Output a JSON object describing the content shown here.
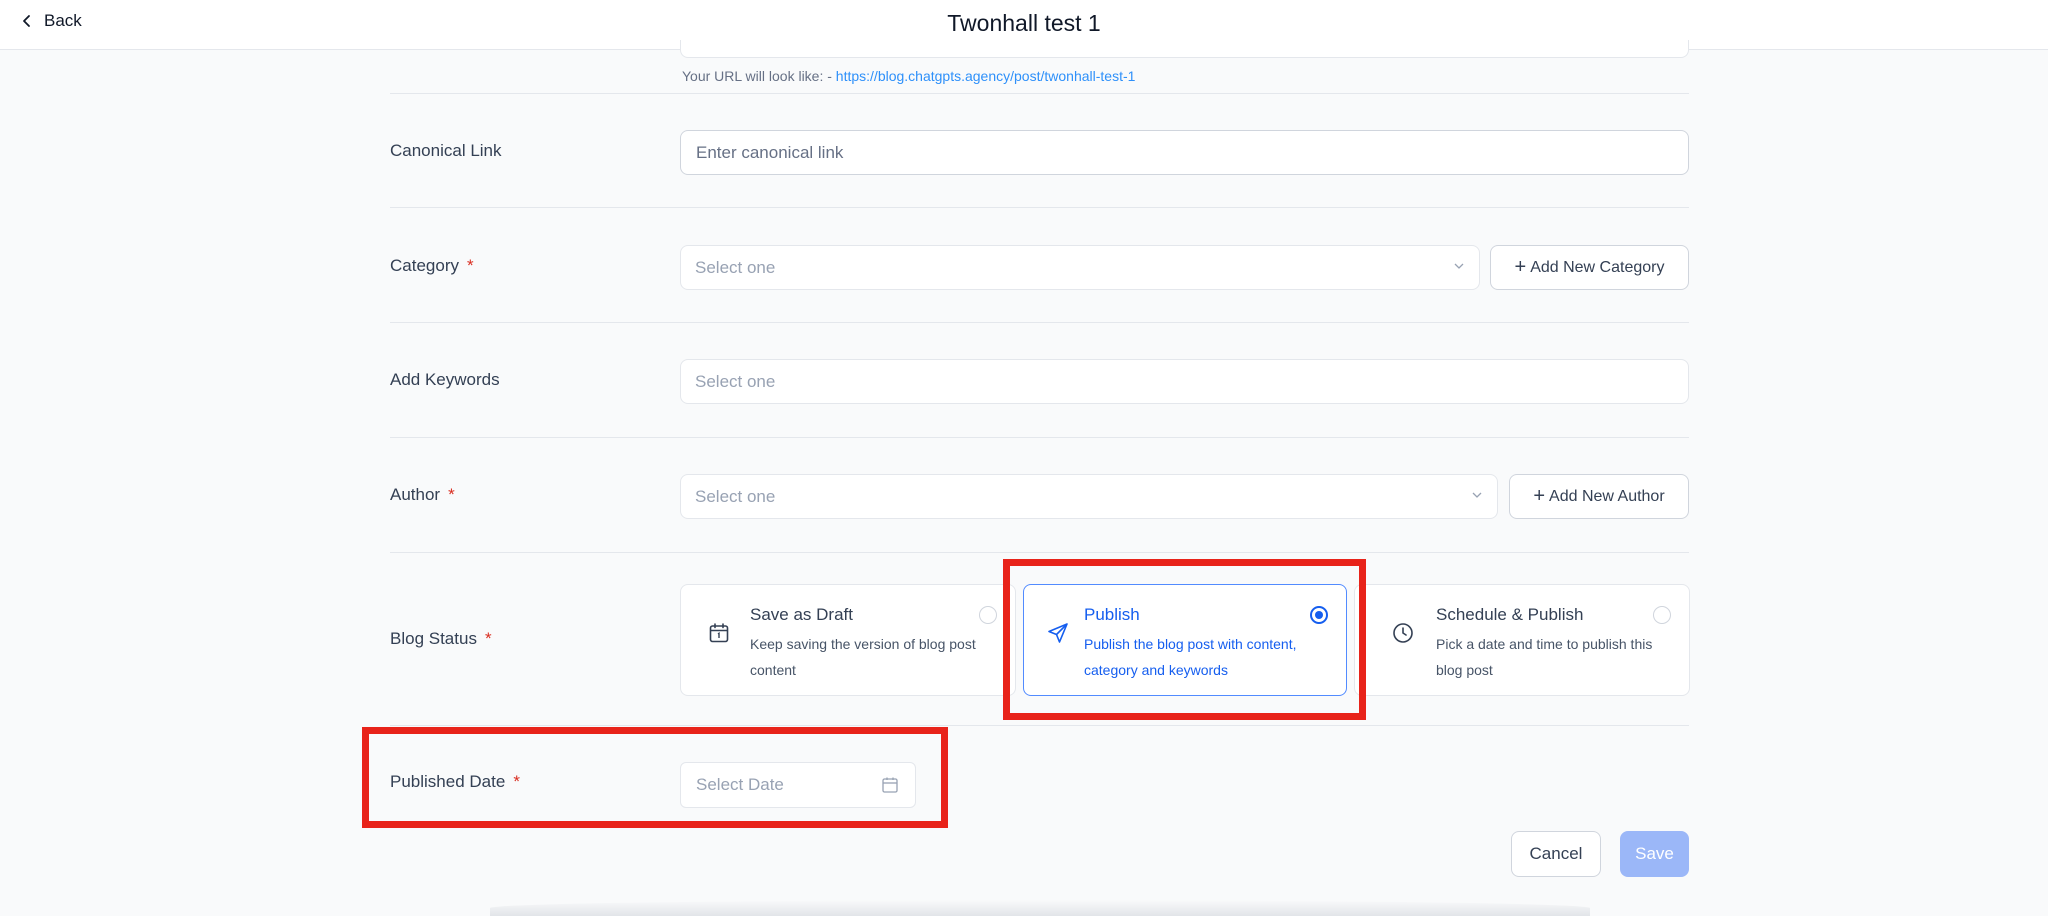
{
  "header": {
    "back_label": "Back",
    "title": "Twonhall test 1"
  },
  "url_hint": {
    "prefix": "Your URL will look like: - ",
    "url": "https://blog.chatgpts.agency/post/twonhall-test-1"
  },
  "canonical": {
    "label": "Canonical Link",
    "placeholder": "Enter canonical link"
  },
  "category": {
    "label": "Category",
    "required": "*",
    "placeholder": "Select one",
    "add_button": "Add New Category"
  },
  "keywords": {
    "label": "Add Keywords",
    "placeholder": "Select one"
  },
  "author": {
    "label": "Author",
    "required": "*",
    "placeholder": "Select one",
    "add_button": "Add New Author"
  },
  "blog_status": {
    "label": "Blog Status",
    "required": "*",
    "selected": "publish",
    "options": [
      {
        "id": "draft",
        "title": "Save as Draft",
        "desc": "Keep saving the version of blog post content"
      },
      {
        "id": "publish",
        "title": "Publish",
        "desc": "Publish the blog post with content, category and keywords"
      },
      {
        "id": "schedule",
        "title": "Schedule & Publish",
        "desc": "Pick a date and time to publish this blog post"
      }
    ]
  },
  "published_date": {
    "label": "Published Date",
    "required": "*",
    "placeholder": "Select Date"
  },
  "actions": {
    "cancel": "Cancel",
    "save": "Save"
  },
  "colors": {
    "accent": "#155eef",
    "highlight": "#e8231a",
    "save_disabled": "#9bb7f8"
  },
  "icons": {
    "back": "chevron-left-icon",
    "select": "chevron-down-icon",
    "draft": "calendar-icon",
    "publish": "send-icon",
    "schedule": "clock-icon",
    "date": "calendar-icon"
  }
}
